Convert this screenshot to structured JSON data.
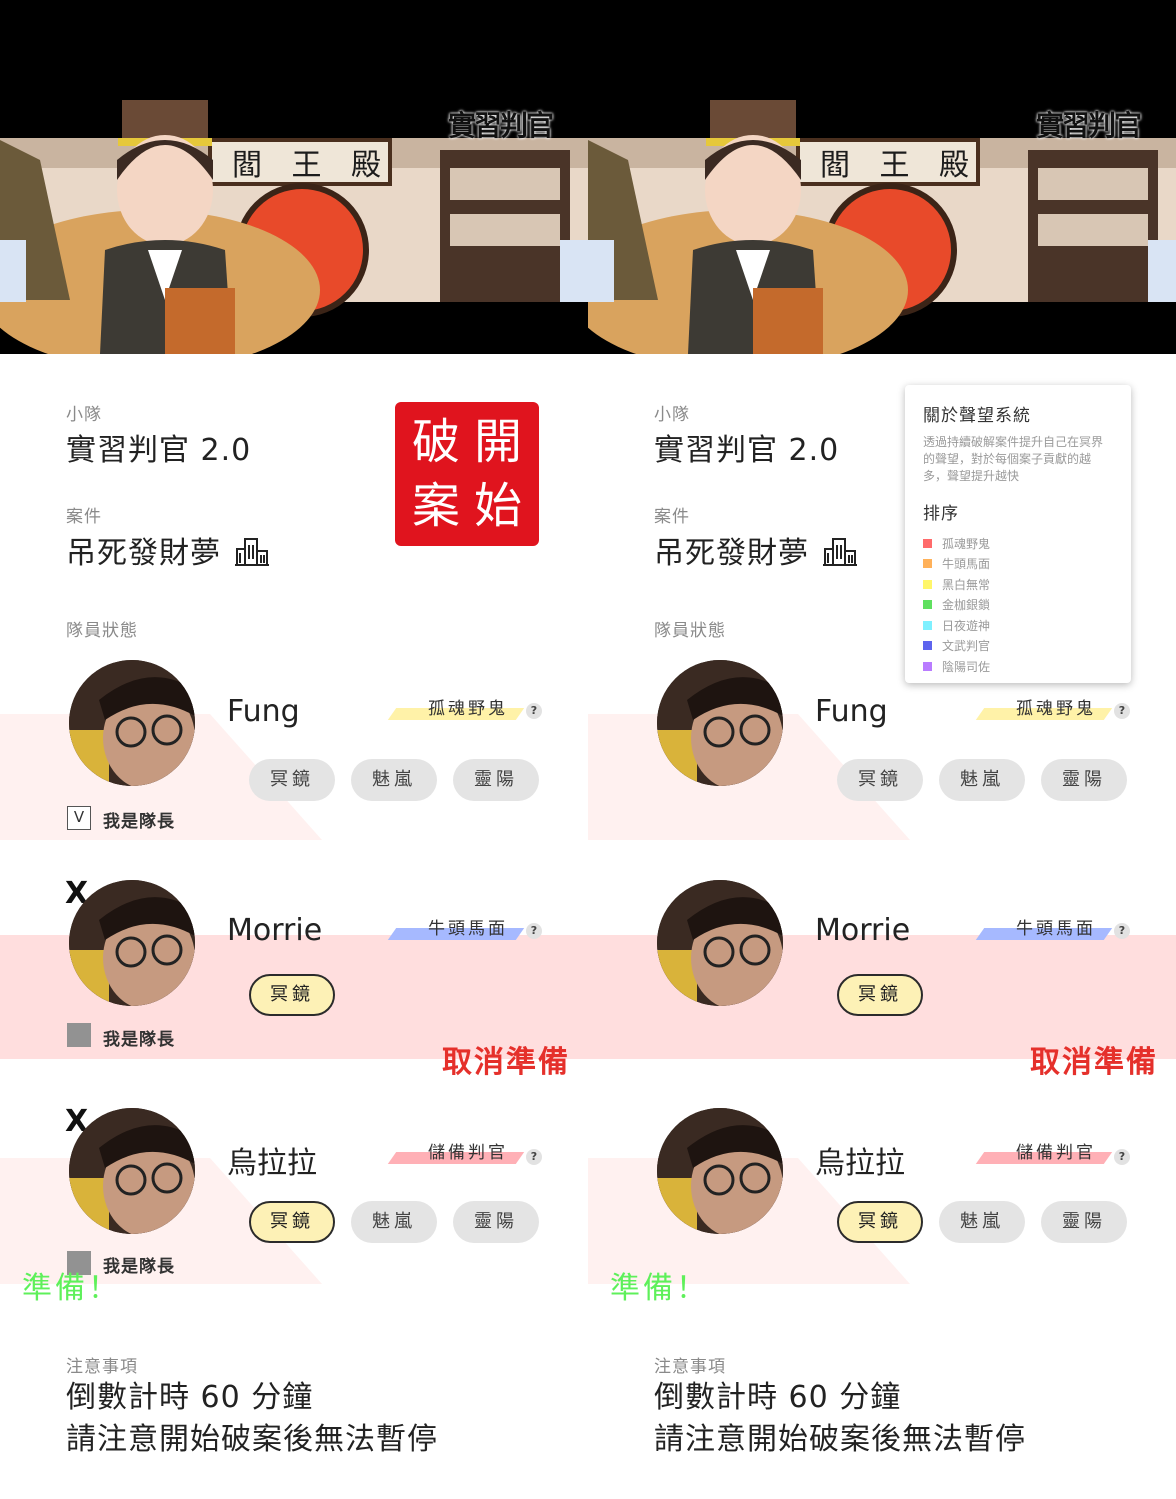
{
  "hero": {
    "hall_sign": "閻 王 殿",
    "logo_text": "實習判官"
  },
  "team": {
    "label": "小隊",
    "name": "實習判官 2.0"
  },
  "case": {
    "label": "案件",
    "name": "吊死發財夢"
  },
  "seal": {
    "chars": [
      "破",
      "開",
      "案",
      "始"
    ]
  },
  "members_label": "隊員狀態",
  "members": [
    {
      "name": "Fung",
      "role": "孤魂野鬼",
      "role_color": "#fff2a8",
      "help": "?",
      "pills": [
        {
          "label": "冥鏡",
          "selected": false
        },
        {
          "label": "魅嵐",
          "selected": false
        },
        {
          "label": "靈陽",
          "selected": false
        }
      ],
      "captain_check": "V",
      "captain_label": "我是隊長",
      "remove": ""
    },
    {
      "name": "Morrie",
      "role": "牛頭馬面",
      "role_color": "#a6b9ff",
      "help": "?",
      "pills": [
        {
          "label": "冥鏡",
          "selected": true
        }
      ],
      "captain_check": "",
      "captain_label": "我是隊長",
      "remove": "X",
      "status": "取消準備"
    },
    {
      "name": "烏拉拉",
      "role": "儲備判官",
      "role_color": "#ffb0b6",
      "help": "?",
      "pills": [
        {
          "label": "冥鏡",
          "selected": true
        },
        {
          "label": "魅嵐",
          "selected": false
        },
        {
          "label": "靈陽",
          "selected": false
        }
      ],
      "captain_check": "",
      "captain_label": "我是隊長",
      "remove": "X",
      "status": "準備！"
    }
  ],
  "notes": {
    "label": "注意事項",
    "line1": "倒數計時 60 分鐘",
    "line2": "請注意開始破案後無法暫停"
  },
  "popover": {
    "title": "關於聲望系統",
    "desc": "透過持續破解案件提升自己在冥界的聲望，對於每個案子貢獻的越多，聲望提升越快",
    "rank_title": "排序",
    "ranks": [
      {
        "label": "孤魂野鬼",
        "color": "#ff6b6b"
      },
      {
        "label": "牛頭馬面",
        "color": "#ffb15a"
      },
      {
        "label": "黑白無常",
        "color": "#fff66a"
      },
      {
        "label": "金枷銀鎖",
        "color": "#5fe05f"
      },
      {
        "label": "日夜遊神",
        "color": "#7ef0ff"
      },
      {
        "label": "文武判官",
        "color": "#5e64ee"
      },
      {
        "label": "陰陽司佐",
        "color": "#b97cff"
      }
    ]
  }
}
